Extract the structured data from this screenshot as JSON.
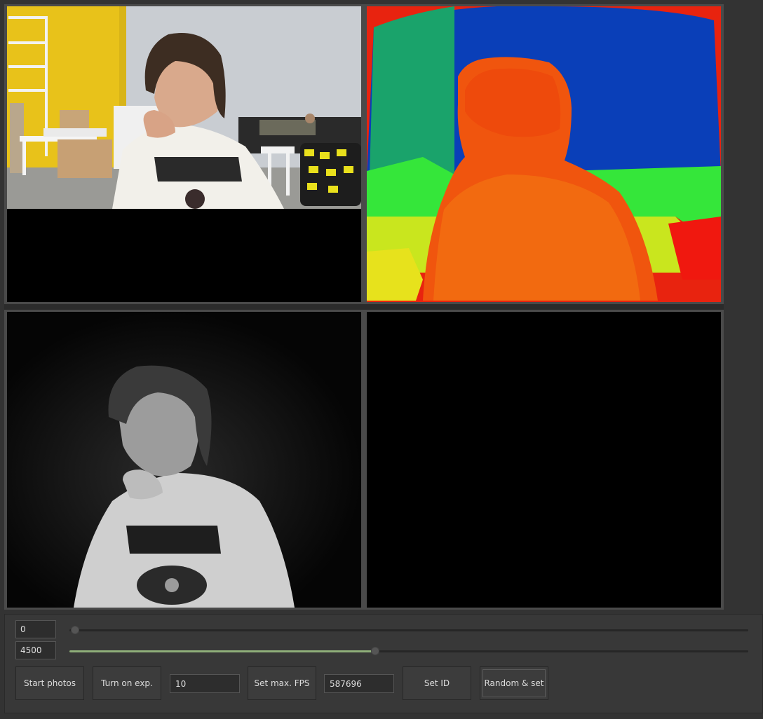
{
  "views": {
    "color": "color-camera-view",
    "depth": "depth-camera-view",
    "ir": "infrared-camera-view",
    "empty": "empty-view"
  },
  "colors": {
    "accent": "#8fae79",
    "background": "#333333",
    "panel": "#383838"
  },
  "range": {
    "min_value": "0",
    "max_value": "4500",
    "min_slider_fraction": 0,
    "max_slider_fraction": 0.45
  },
  "toolbar": {
    "start_photos_label": "Start photos",
    "turn_on_exp_label": "Turn on exp.",
    "fps_value": "10",
    "set_max_fps_label": "Set max. FPS",
    "id_value": "587696",
    "set_id_label": "Set ID",
    "random_set_label": "Random & set"
  }
}
